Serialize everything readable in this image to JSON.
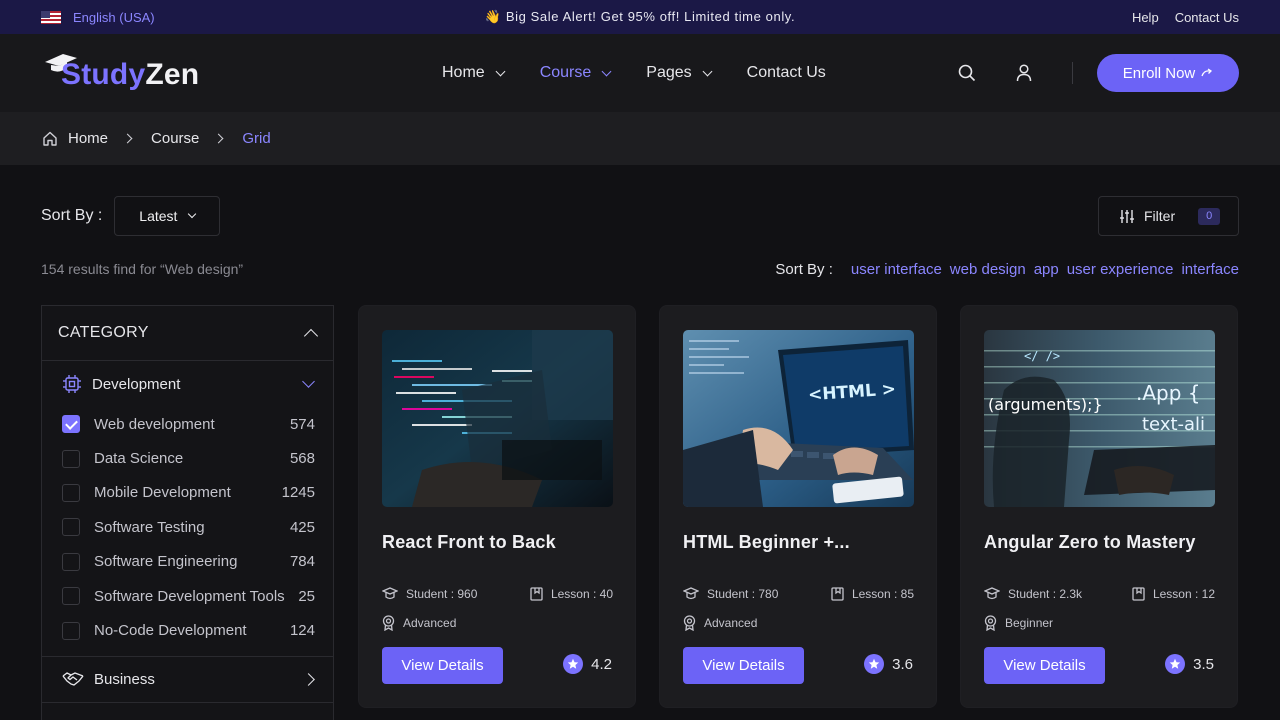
{
  "topbar": {
    "language": "English (USA)",
    "promo_emoji": "👋",
    "promo": "Big Sale Alert! Get 95% off! Limited time only.",
    "help": "Help",
    "contact": "Contact Us"
  },
  "header": {
    "logo_a": "Study",
    "logo_b": "Zen",
    "nav": [
      {
        "label": "Home",
        "has_dropdown": true,
        "active": false
      },
      {
        "label": "Course",
        "has_dropdown": true,
        "active": true
      },
      {
        "label": "Pages",
        "has_dropdown": true,
        "active": false
      },
      {
        "label": "Contact Us",
        "has_dropdown": false,
        "active": false
      }
    ],
    "enroll": "Enroll Now"
  },
  "breadcrumb": {
    "home": "Home",
    "course": "Course",
    "current": "Grid"
  },
  "toolbar": {
    "sort_label": "Sort By :",
    "sort_value": "Latest",
    "filter_label": "Filter",
    "filter_count": "0"
  },
  "results_text": "154 results find for “Web design”",
  "tags": {
    "label": "Sort By :",
    "items": [
      "user interface",
      "web design",
      "app",
      "user experience",
      "interface"
    ]
  },
  "sidebar": {
    "heading": "CATEGORY",
    "group1": "Development",
    "items": [
      {
        "label": "Web development",
        "count": "574",
        "checked": true
      },
      {
        "label": "Data Science",
        "count": "568",
        "checked": false
      },
      {
        "label": "Mobile Development",
        "count": "1245",
        "checked": false
      },
      {
        "label": "Software Testing",
        "count": "425",
        "checked": false
      },
      {
        "label": "Software Engineering",
        "count": "784",
        "checked": false
      },
      {
        "label": "Software Development Tools",
        "count": "25",
        "checked": false
      },
      {
        "label": "No-Code Development",
        "count": "124",
        "checked": false
      }
    ],
    "group2": "Business"
  },
  "cards": [
    {
      "title": "React Front to Back",
      "students": "Student : 960",
      "lessons": "Lesson : 40",
      "level": "Advanced",
      "button": "View Details",
      "rating": "4.2"
    },
    {
      "title": "HTML Beginner +...",
      "students": "Student : 780",
      "lessons": "Lesson : 85",
      "level": "Advanced",
      "button": "View Details",
      "rating": "3.6",
      "thumb_text": "<HTML >"
    },
    {
      "title": "Angular Zero to Mastery",
      "students": "Student : 2.3k",
      "lessons": "Lesson : 12",
      "level": "Beginner",
      "button": "View Details",
      "rating": "3.5",
      "thumb_lines": [
        "</ />",
        "(arguments);}",
        ".App {",
        "text-ali"
      ]
    }
  ]
}
